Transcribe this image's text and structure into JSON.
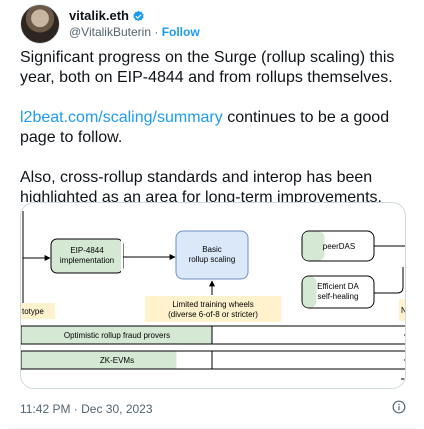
{
  "author": {
    "display_name": "vitalik.eth",
    "handle": "@VitalikButerin",
    "separator": "·",
    "follow_label": "Follow",
    "verified_color": "#1d9bf0"
  },
  "tweet": {
    "paragraph1": "Significant progress on the Surge (rollup scaling) this year, both on EIP-4844 and from rollups themselves.",
    "link_text": "l2beat.com/scaling/summary",
    "paragraph2_rest": " continues to be a good page to follow.",
    "paragraph3": "Also, cross-rollup standards and interop has been highlighted as an area for long-term improvements."
  },
  "diagram": {
    "node_eip4844_line1": "EIP-4844",
    "node_eip4844_line2": "implementation",
    "node_basic_line1": "Basic",
    "node_basic_line2": "rollup scaling",
    "node_peerdas": "peerDAS",
    "node_efficient_line1": "Efficient DA",
    "node_efficient_line2": "self-healing",
    "label_prototype": "totype",
    "label_training_line1": "Limited training wheels",
    "label_training_line2": "(diverse 6-of-8 or stricter)",
    "label_edge_n": "N",
    "bar_fraud_provers": "Optimistic rollup fraud provers",
    "bar_zk_evms": "ZK-EVMs",
    "colors": {
      "blue_fill": "#dbe8fa",
      "blue_stroke": "#6c8ebf",
      "green_fill": "#d5e8d4",
      "green_stroke": "#82b366",
      "yellow_fill": "#fff2cc"
    }
  },
  "footer": {
    "timestamp": "11:42 PM · Dec 30, 2023",
    "info_icon": "info-icon"
  }
}
